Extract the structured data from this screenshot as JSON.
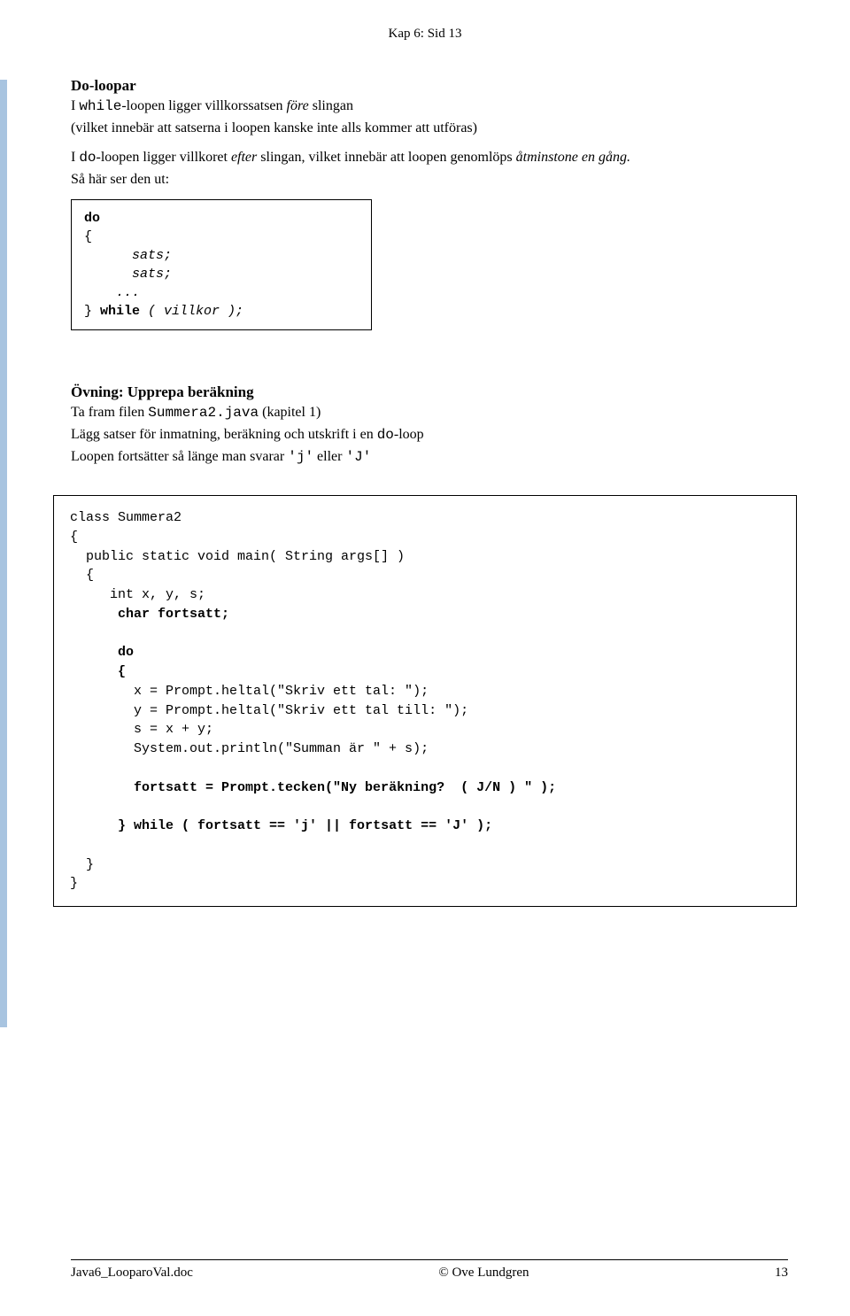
{
  "header": "Kap 6:  Sid 13",
  "section1": {
    "title": "Do-loopar",
    "line1_pre": "I ",
    "line1_mono": "while",
    "line1_post": "-loopen ligger villkorssatsen ",
    "line1_italic": "före",
    "line1_end": " slingan",
    "line2": "(vilket innebär att satserna i loopen kanske inte alls kommer att utföras)",
    "line3_pre": "I ",
    "line3_mono": "do",
    "line3_post": "-loopen ligger villkoret ",
    "line3_italic": "efter",
    "line3_end": " slingan, vilket innebär att loopen genomlöps ",
    "line3_italic2": "åtminstone en gång.",
    "line4": "Så här ser den ut:"
  },
  "syntax_box": {
    "l1_bold": "do",
    "l2": "{",
    "l3": "      sats;",
    "l4": "      sats;",
    "l5": "    ...",
    "l6_close": "} ",
    "l6_bold": "while",
    "l6_rest": " ( villkor );"
  },
  "section2": {
    "title": "Övning:  Upprepa beräkning",
    "line1_pre": "Ta fram filen ",
    "line1_mono": "Summera2.java",
    "line1_post": " (kapitel 1)",
    "line2_pre": "Lägg  satser för inmatning, beräkning och utskrift i en ",
    "line2_mono": "do",
    "line2_post": "-loop",
    "line3_pre": "Loopen fortsätter så länge man svarar ",
    "line3_mono1": "'j'",
    "line3_mid": "  eller   ",
    "line3_mono2": "'J'"
  },
  "code": {
    "l1": "class Summera2",
    "l2": "{",
    "l3": "  public static void main( String args[] )",
    "l4": "  {",
    "l5": "     int x, y, s;",
    "l6_pre": "      ",
    "l6_bold": "char fortsatt;",
    "l7": "",
    "l8_pre": "      ",
    "l8_bold": "do",
    "l9_pre": "      ",
    "l9_bold": "{",
    "l10": "        x = Prompt.heltal(\"Skriv ett tal: \");",
    "l11": "        y = Prompt.heltal(\"Skriv ett tal till: \");",
    "l12": "        s = x + y;",
    "l13": "        System.out.println(\"Summan är \" + s);",
    "l14": "",
    "l15_pre": "        ",
    "l15_bold": "fortsatt = Prompt.tecken(\"Ny beräkning?  ( J/N ) \" );",
    "l16": "",
    "l17_pre": "      ",
    "l17_bold": "} while ( fortsatt == 'j' || fortsatt == 'J' );",
    "l18": "",
    "l19": "  }",
    "l20": "}"
  },
  "footer": {
    "left": "Java6_LooparoVal.doc",
    "center": "© Ove Lundgren",
    "right": "13"
  }
}
